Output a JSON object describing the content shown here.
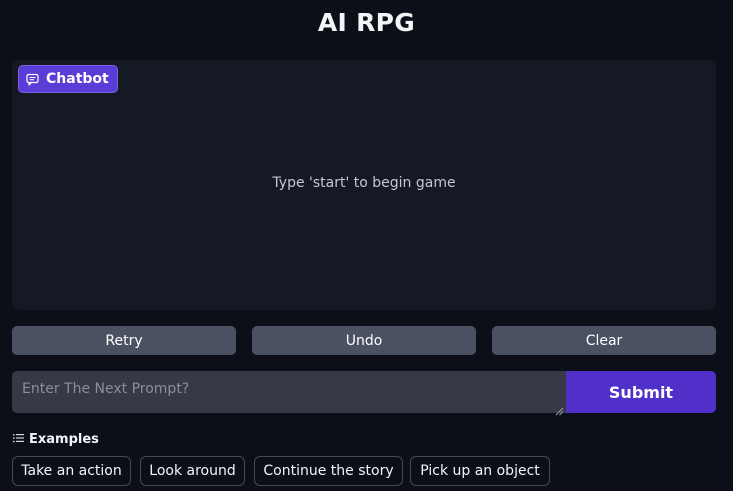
{
  "app": {
    "title": "AI RPG"
  },
  "chatbot": {
    "label": "Chatbot",
    "icon": "chat-bubble-icon",
    "empty_message": "Type 'start' to begin game"
  },
  "actions": {
    "retry": "Retry",
    "undo": "Undo",
    "clear": "Clear"
  },
  "prompt": {
    "value": "",
    "placeholder": "Enter The Next Prompt?",
    "submit_label": "Submit"
  },
  "examples": {
    "heading": "Examples",
    "icon": "list-icon",
    "items": [
      "Take an action",
      "Look around",
      "Continue the story",
      "Pick up an object"
    ]
  },
  "colors": {
    "background": "#0c0f17",
    "panel": "#151923",
    "accent": "#5130c9",
    "button": "#4a5160",
    "input": "#353a46"
  }
}
